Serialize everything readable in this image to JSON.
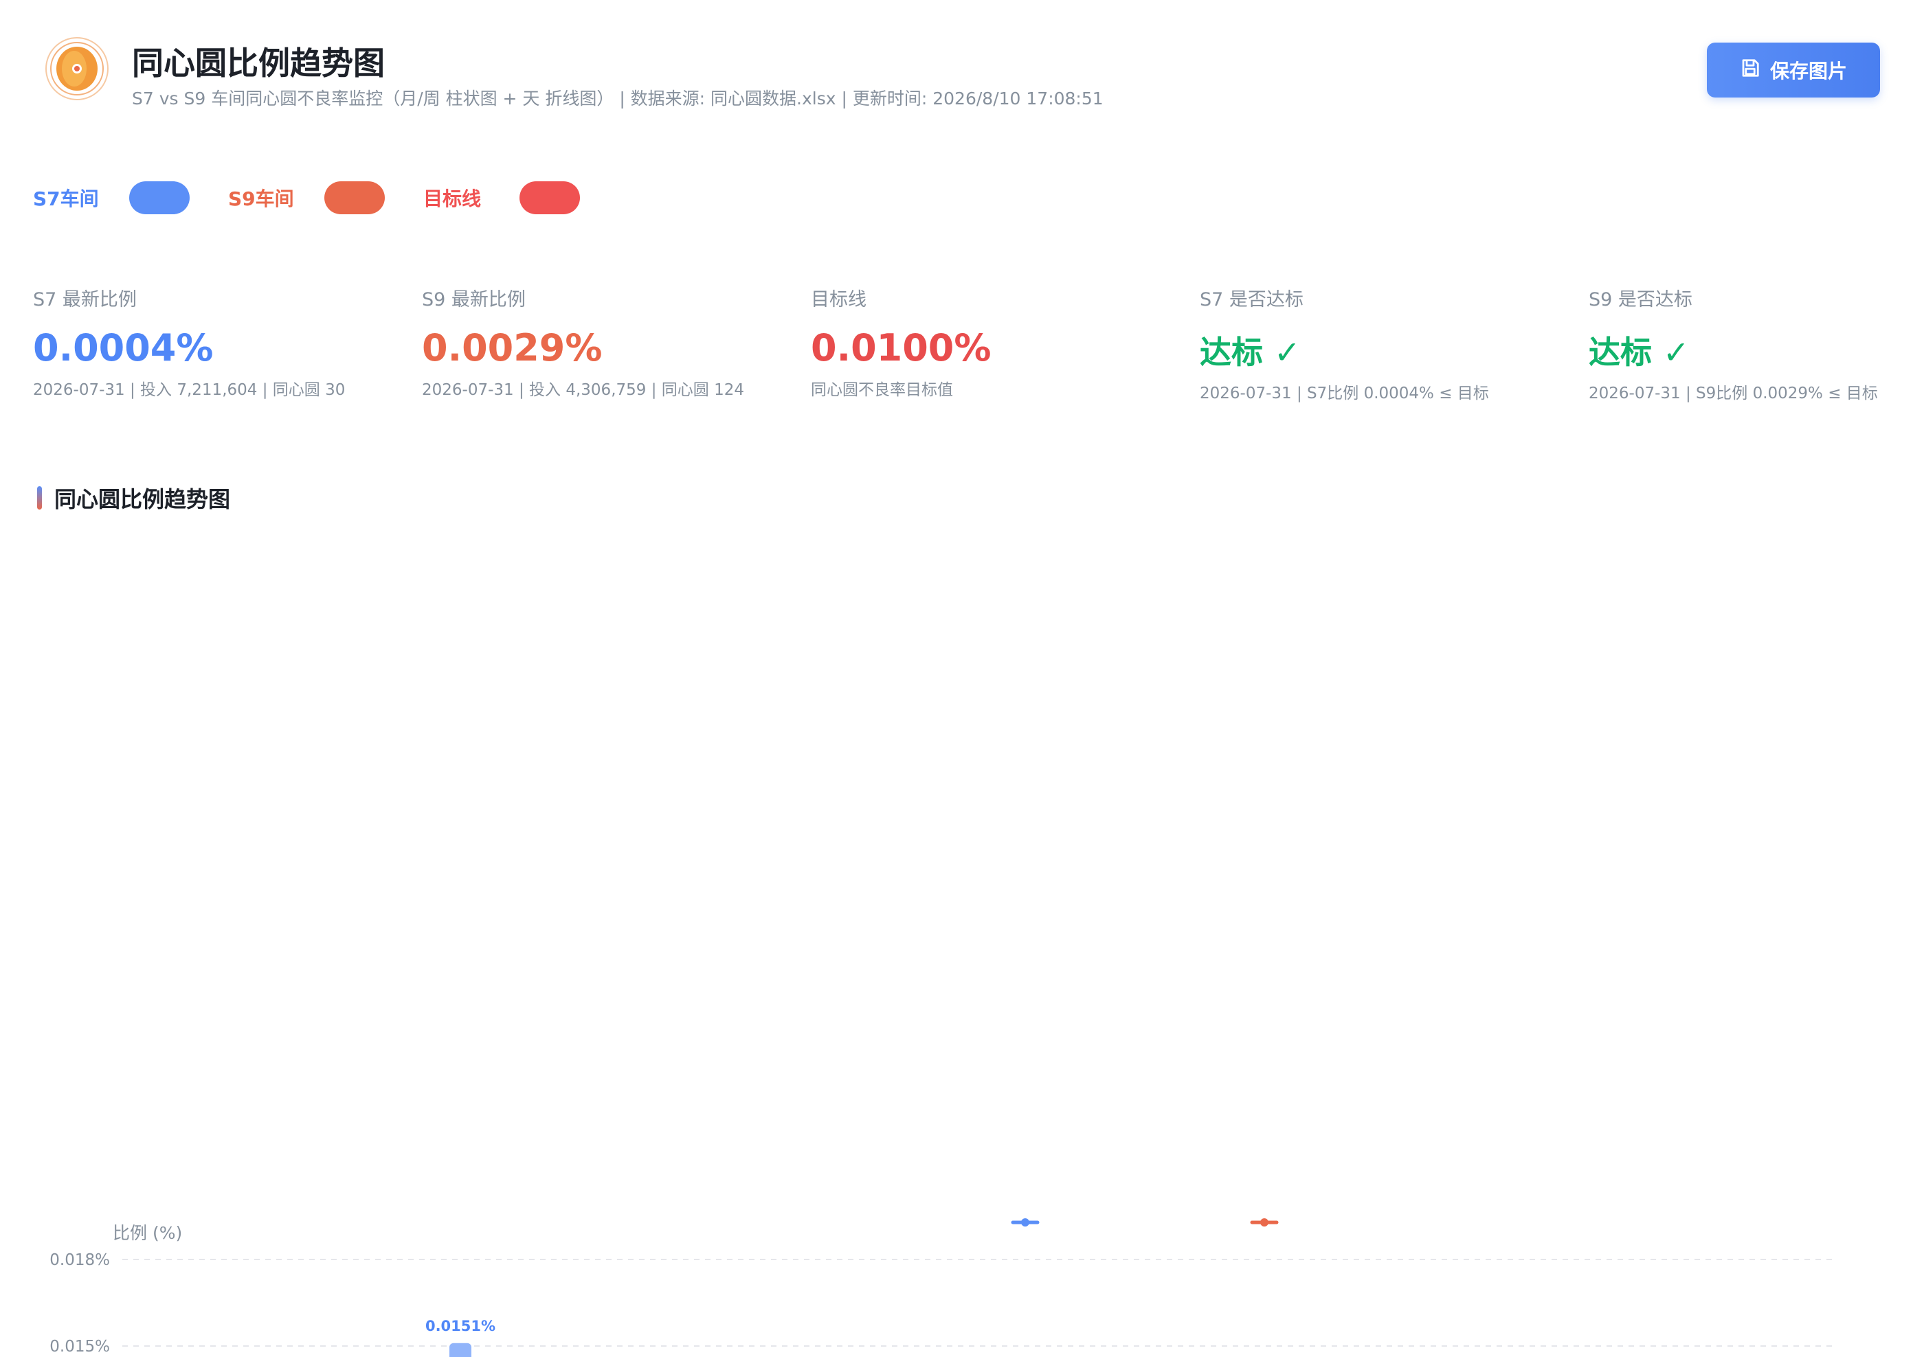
{
  "header": {
    "title": "同心圆比例趋势图",
    "subtitle": "S7 vs S9 车间同心圆不良率监控（月/周 柱状图 + 天 折线图） | 数据来源: 同心圆数据.xlsx | 更新时间: 2026/8/10 17:08:51",
    "save_label": "保存图片",
    "logo_icon": "concentric-circle-logo",
    "save_icon": "floppy-disk-icon"
  },
  "legend": [
    {
      "label": "S7车间",
      "color": "#5b8ff7"
    },
    {
      "label": "S9车间",
      "color": "#e9684a"
    },
    {
      "label": "目标线",
      "color": "#f05252"
    }
  ],
  "stats": [
    {
      "label": "S7 最新比例",
      "value": "0.0004%",
      "meta": "2026-07-31 | 投入 7,211,604 | 同心圆 30",
      "color": "#4f86f7"
    },
    {
      "label": "S9 最新比例",
      "value": "0.0029%",
      "meta": "2026-07-31 | 投入 4,306,759 | 同心圆 124",
      "color": "#e9684a"
    },
    {
      "label": "目标线",
      "value": "0.0100%",
      "meta": "同心圆不良率目标值",
      "color": "#e84c4c"
    },
    {
      "label": "S7 是否达标",
      "value": "达标 ✓",
      "meta": "2026-07-31 | S7比例 0.0004% ≤ 目标",
      "color": "#12b36b"
    },
    {
      "label": "S9 是否达标",
      "value": "达标 ✓",
      "meta": "2026-07-31 | S9比例 0.0029% ≤ 目标",
      "color": "#12b36b"
    }
  ],
  "section": {
    "title": "同心圆比例趋势图"
  },
  "chart_data": {
    "type": "bar",
    "ylabel": "比例 (%)",
    "y_ticks": [
      "0.018%",
      "0.015%"
    ],
    "ylim": [
      0.015,
      0.018
    ],
    "grid": true,
    "legend_placement": "top-center",
    "series": [
      {
        "color": "#5b8ff7",
        "values": [
          0.0151
        ]
      },
      {
        "color": "#e9684a",
        "values": []
      }
    ],
    "data_labels": [
      "0.0151%"
    ]
  }
}
